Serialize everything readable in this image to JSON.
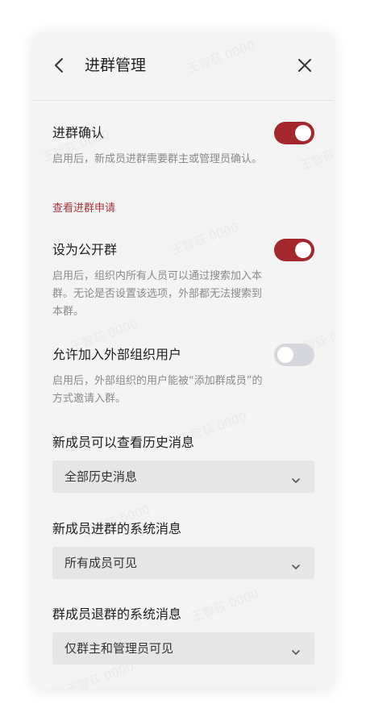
{
  "header": {
    "title": "进群管理",
    "back_icon": "chevron-left-icon",
    "close_icon": "close-icon"
  },
  "settings": {
    "join_confirm": {
      "title": "进群确认",
      "desc": "启用后，新成员进群需要群主或管理员确认。",
      "enabled": true,
      "link": "查看进群申请"
    },
    "public_group": {
      "title": "设为公开群",
      "desc": "启用后，组织内所有人员可以通过搜索加入本群。无论是否设置该选项，外部都无法搜索到本群。",
      "enabled": true
    },
    "external_users": {
      "title": "允许加入外部组织用户",
      "desc": "启用后，外部组织的用户能被“添加群成员”的方式邀请入群。",
      "enabled": false
    },
    "history": {
      "label": "新成员可以查看历史消息",
      "value": "全部历史消息"
    },
    "join_message": {
      "label": "新成员进群的系统消息",
      "value": "所有成员可见"
    },
    "leave_message": {
      "label": "群成员退群的系统消息",
      "value": "仅群主和管理员可见"
    }
  },
  "watermark": "王智荻 0000",
  "colors": {
    "accent": "#a5272e",
    "toggle_off": "#d5d7dc",
    "link": "#a8323a"
  }
}
